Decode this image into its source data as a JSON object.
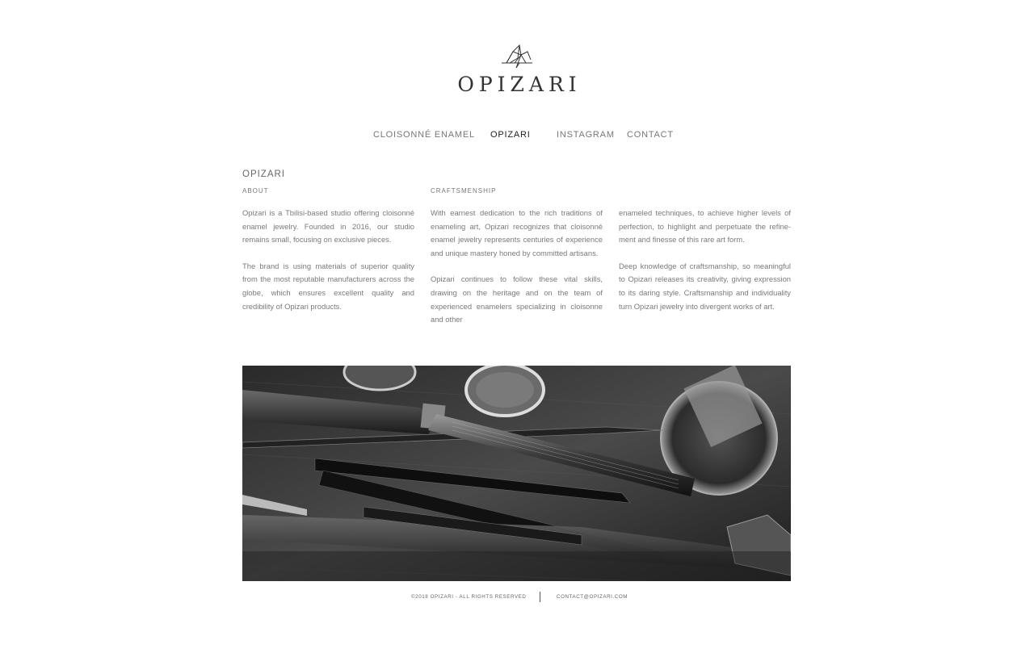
{
  "brand": {
    "name": "OPIZARI",
    "logo_icon": "geometric-bird-icon"
  },
  "nav": {
    "items": [
      {
        "label": "CLOISONNÉ ENAMEL",
        "active": false
      },
      {
        "label": "OPIZARI",
        "active": true
      },
      {
        "label": "INSTAGRAM",
        "active": false
      },
      {
        "label": "CONTACT",
        "active": false
      }
    ]
  },
  "content": {
    "title": "OPIZARI",
    "columns": [
      {
        "heading": "ABOUT",
        "paragraphs": [
          "Opizari is a Tbilisi-based studio offering cloisonné enamel jewelry. Founded in 2016, our studio remains small, focusing on exclusive pieces.",
          "The brand is using materials of superior quality from the most reputable manufacturers across the globe, which ensures excellent quality and credibility of Opizari products."
        ]
      },
      {
        "heading": "CRAFTSMENSHIP",
        "paragraphs": [
          "With earnest dedication to the rich traditions of enameling art, Opizari recognizes that cloisonné enamel jewelry represents centuries of experience and unique mastery honed by committed artisans.",
          "Opizari continues to follow these vital skills, drawing on the heritage and on the team of experienced enamelers specializing in cloisonne and other"
        ]
      },
      {
        "heading": "",
        "paragraphs": [
          "enameled techniques, to achieve higher levels of perfection, to highlight and perpetuate the refine-ment and finesse of this rare art form.",
          "Deep knowledge of craftsmanship, so meaningful to Opizari releases its creativity, giving expression to its daring style. Craftsmanship and individuality turn Opizari jewelry into divergent works of art."
        ]
      }
    ]
  },
  "hero_image": {
    "description_icon": "workbench-tools-photo"
  },
  "footer": {
    "copyright": "©2018 OPIZARI - ALL RIGHTS RESERVED",
    "contact": "CONTACT@OPIZARI.COM"
  }
}
